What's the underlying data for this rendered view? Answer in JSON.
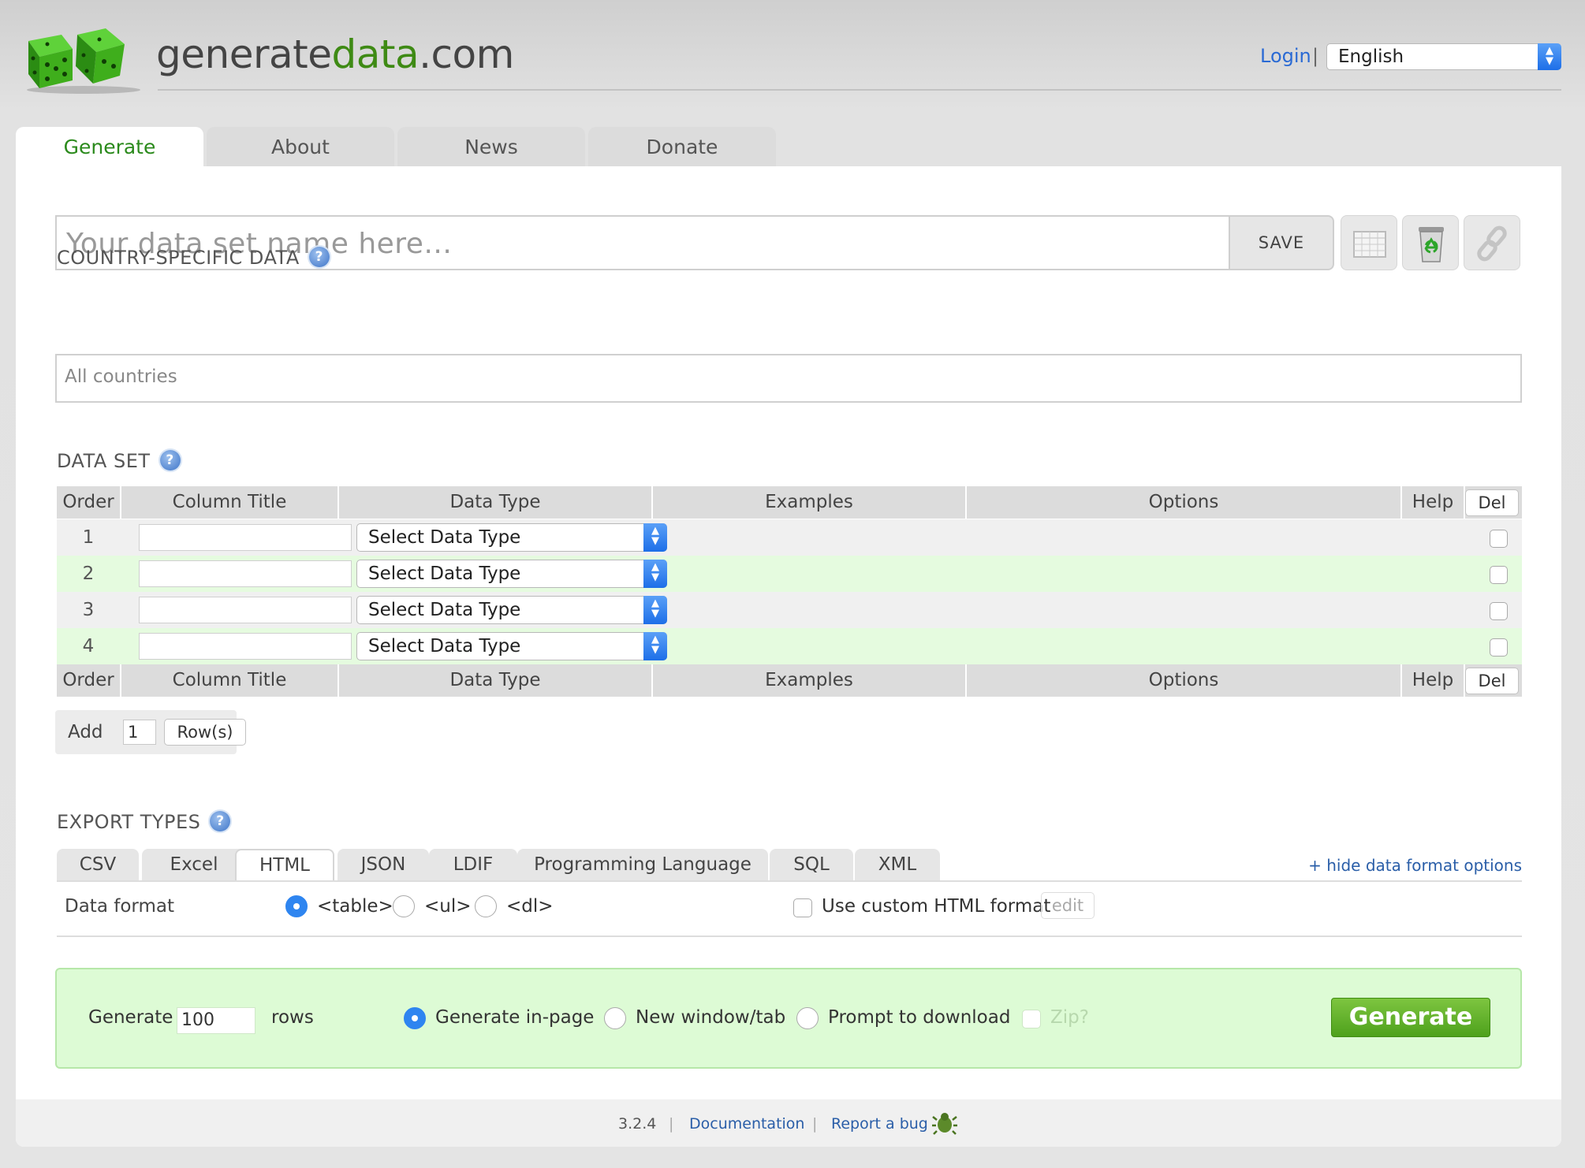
{
  "header": {
    "brand_prefix": "generate",
    "brand_green": "data",
    "brand_suffix": ".com",
    "login": "Login",
    "separator": "|",
    "language": "English"
  },
  "tabs": [
    "Generate",
    "About",
    "News",
    "Donate"
  ],
  "name_bar": {
    "placeholder": "Your data set name here...",
    "save_label": "SAVE"
  },
  "icons": [
    "grid-icon",
    "recycle-bin-icon",
    "link-icon",
    "help-icon",
    "bug-icon"
  ],
  "country": {
    "heading": "COUNTRY-SPECIFIC DATA",
    "placeholder": "All countries"
  },
  "data_set": {
    "heading": "DATA SET",
    "columns": [
      "Order",
      "Column Title",
      "Data Type",
      "Examples",
      "Options",
      "Help",
      "Del"
    ],
    "rows": [
      {
        "order": "1",
        "data_type": "Select Data Type"
      },
      {
        "order": "2",
        "data_type": "Select Data Type"
      },
      {
        "order": "3",
        "data_type": "Select Data Type"
      },
      {
        "order": "4",
        "data_type": "Select Data Type"
      }
    ]
  },
  "add_rows": {
    "label": "Add",
    "count": "1",
    "button": "Row(s)"
  },
  "export": {
    "heading": "EXPORT TYPES",
    "tabs": [
      "CSV",
      "Excel",
      "HTML",
      "JSON",
      "LDIF",
      "Programming Language",
      "SQL",
      "XML"
    ],
    "active_tab": "HTML",
    "hide_link": "+ hide data format options",
    "data_format_label": "Data format",
    "formats": [
      "<table>",
      "<ul>",
      "<dl>"
    ],
    "selected_format": "<table>",
    "custom_label": "Use custom HTML format",
    "edit_label": "edit"
  },
  "generate": {
    "label": "Generate",
    "rows_value": "100",
    "rows_label": "rows",
    "options": [
      "Generate in-page",
      "New window/tab",
      "Prompt to download"
    ],
    "selected_option": "Generate in-page",
    "zip_label": "Zip?",
    "button": "Generate"
  },
  "footer": {
    "version": "3.2.4",
    "sep": "|",
    "documentation": "Documentation",
    "report_bug": "Report a bug"
  },
  "colors": {
    "brand_green": "#3e8a14",
    "link_blue": "#2a5ea8",
    "generate_button": "#5aab24",
    "even_row": "#e5fbdf"
  }
}
